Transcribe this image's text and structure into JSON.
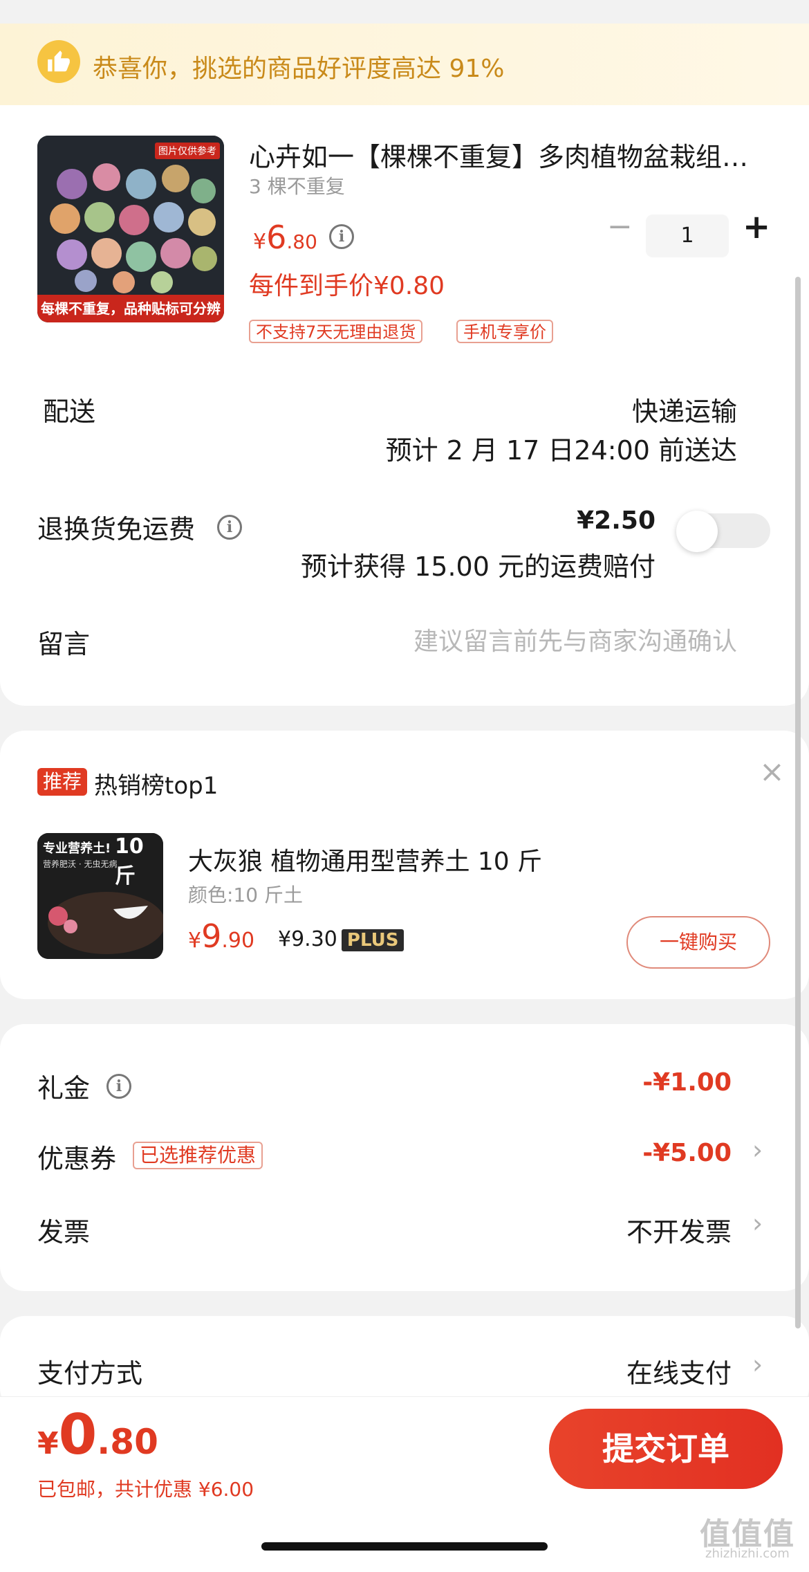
{
  "banner": {
    "text": "恭喜你，挑选的商品好评度高达 91%",
    "icon": "thumbs-up-icon"
  },
  "product": {
    "title": "心卉如一【棵棵不重复】多肉植物盆栽组…",
    "variant": "3 棵不重复",
    "image_corner_tag": "图片仅供参考",
    "image_caption": "每棵不重复，品种贴标可分辨",
    "price_symbol": "¥",
    "price_int": "6",
    "price_dec": ".80",
    "unit_price": "每件到手价¥0.80",
    "quantity": "1",
    "minus": "−",
    "plus": "+",
    "tags": [
      "不支持7天无理由退货",
      "手机专享价"
    ]
  },
  "delivery": {
    "label": "配送",
    "method": "快递运输",
    "eta": "预计 2 月 17 日24:00 前送达"
  },
  "return_shipping": {
    "label": "退换货免运费",
    "price": "¥2.50",
    "note": "预计获得 15.00 元的运费赔付",
    "enabled": false
  },
  "message": {
    "label": "留言",
    "placeholder": "建议留言前先与商家沟通确认"
  },
  "recommend": {
    "badge": "推荐",
    "title": "热销榜top1",
    "close": "×",
    "image_text_top": "专业营养土!",
    "image_text_weight": "10斤",
    "image_text_sub": "营养肥沃 · 无虫无病",
    "product_title": "大灰狼 植物通用型营养土 10 斤",
    "variant": "颜色:10 斤土",
    "price_symbol": "¥",
    "price_int": "9",
    "price_dec": ".90",
    "plus_price": "¥9.30",
    "plus_label": "PLUS",
    "buy_button": "一键购买"
  },
  "discounts": {
    "gift_label": "礼金",
    "gift_value": "-¥1.00",
    "coupon_label": "优惠券",
    "coupon_tag": "已选推荐优惠",
    "coupon_value": "-¥5.00",
    "invoice_label": "发票",
    "invoice_value": "不开发票",
    "chevron": "›"
  },
  "payment": {
    "label": "支付方式",
    "value": "在线支付"
  },
  "footer": {
    "total_symbol": "¥",
    "total_int": "0",
    "total_dec": ".80",
    "note": "已包邮，共计优惠 ¥6.00",
    "submit": "提交订单"
  },
  "watermark": {
    "text": "值值值",
    "url": "zhizhizhi.com"
  },
  "colors": {
    "accent_red": "#e03a22",
    "banner_bg": "#fdf3d6",
    "banner_text": "#c98a1a"
  }
}
